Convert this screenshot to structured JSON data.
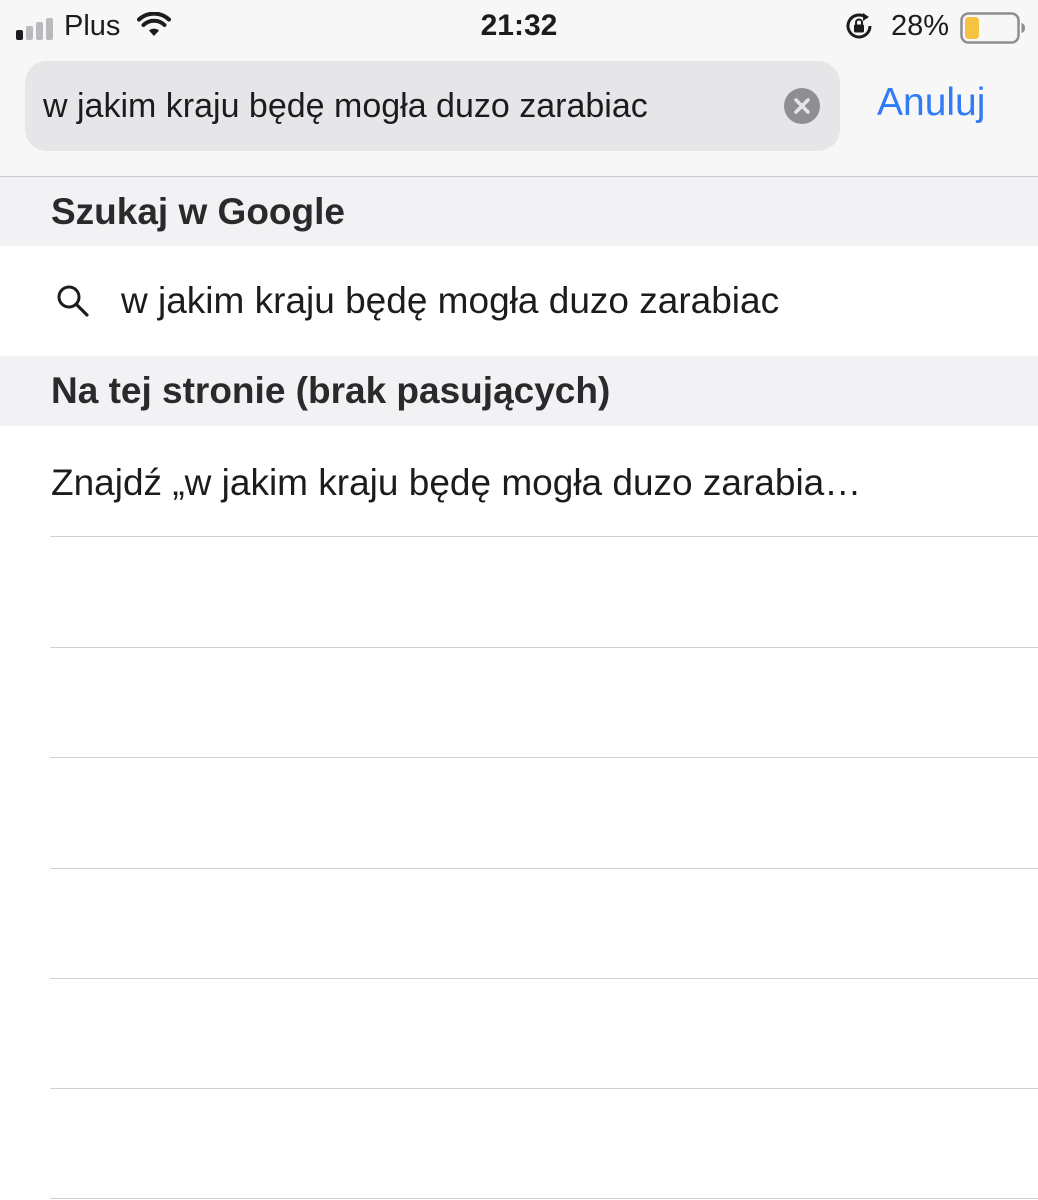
{
  "status_bar": {
    "carrier": "Plus",
    "time": "21:32",
    "battery_percent": "28%",
    "battery_level": 0.28,
    "battery_color": "#f5c242",
    "signal_bars_active": 1,
    "signal_bars_total": 4,
    "icons": [
      "signal-icon",
      "wifi-icon",
      "rotation-lock-icon",
      "battery-icon"
    ]
  },
  "search": {
    "query": "w jakim kraju będę mogła duzo zarabiac",
    "clear_icon": "clear-icon",
    "cancel_label": "Anuluj",
    "accent_color": "#2f7cf6"
  },
  "sections": {
    "google": {
      "title": "Szukaj w Google",
      "suggestion": "w jakim kraju będę mogła duzo zarabiac",
      "icon": "search-icon"
    },
    "on_page": {
      "title": "Na tej stronie (brak pasujących)",
      "find_label": "Znajdź „w jakim kraju będę mogła duzo zarabia…"
    }
  }
}
